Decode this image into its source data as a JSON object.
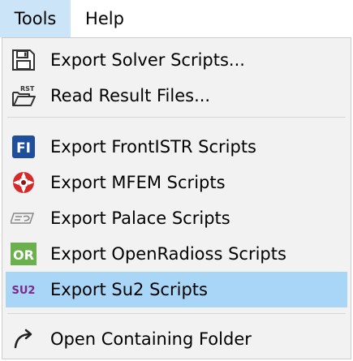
{
  "menubar": {
    "items": [
      {
        "label": "Tools"
      },
      {
        "label": "Help"
      }
    ]
  },
  "menu": {
    "items": [
      {
        "label": "Export Solver Scripts...",
        "icon": "floppy-disk-icon"
      },
      {
        "label": "Read Result Files...",
        "icon": "open-folder-rst-icon",
        "icon_text": "RST"
      },
      {
        "label": "Export FrontISTR Scripts",
        "icon": "frontistr-logo-icon",
        "icon_text": "FI"
      },
      {
        "label": "Export MFEM Scripts",
        "icon": "mfem-logo-icon"
      },
      {
        "label": "Export Palace Scripts",
        "icon": "palace-logo-icon"
      },
      {
        "label": "Export OpenRadioss Scripts",
        "icon": "openradioss-logo-icon",
        "icon_text": "OR"
      },
      {
        "label": "Export Su2 Scripts",
        "icon": "su2-logo-icon",
        "icon_text": "SU2"
      },
      {
        "label": "Open Containing Folder",
        "icon": "open-arrow-icon"
      }
    ],
    "highlighted_item": "Export Su2 Scripts"
  },
  "colors": {
    "menubar_open": "#cce4f7",
    "menu_background": "#f2f2f2",
    "highlight": "#a9d6f7",
    "frontistr_blue": "#1f4e9c",
    "openradioss_green": "#6ab04c",
    "su2_purple": "#7a2a8a",
    "mfem_red": "#d62a2a"
  }
}
